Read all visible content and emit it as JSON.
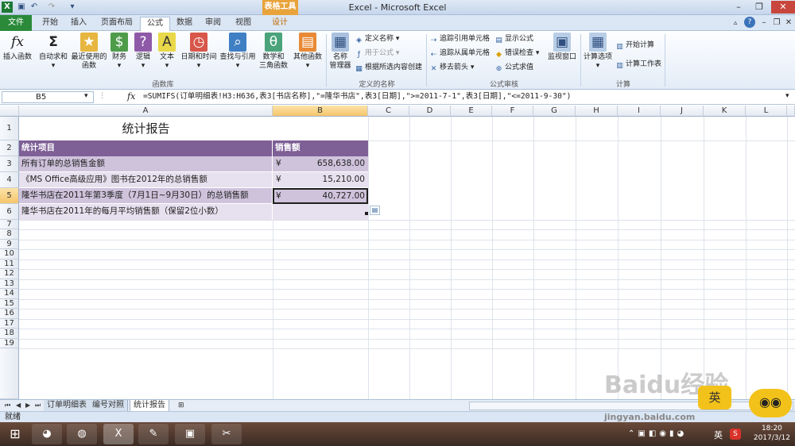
{
  "window": {
    "title": "Excel - Microsoft Excel",
    "context_tab": "表格工具"
  },
  "tabs": [
    "文件",
    "开始",
    "插入",
    "页面布局",
    "公式",
    "数据",
    "审阅",
    "视图",
    "设计"
  ],
  "ribbon": {
    "insert_fn": "插入函数",
    "autosum": "自动求和",
    "recent": "最近使用的\n函数",
    "finance": "财务",
    "logic": "逻辑",
    "text": "文本",
    "datetime": "日期和时间",
    "lookup": "查找与引用",
    "math": "数学和\n三角函数",
    "other": "其他函数",
    "group_fnlib": "函数库",
    "name_mgr": "名称\n管理器",
    "define_name": "定义名称",
    "use_in_formula": "用于公式",
    "create_from_sel": "根据所选内容创建",
    "group_names": "定义的名称",
    "trace_prec": "追踪引用单元格",
    "trace_dep": "追踪从属单元格",
    "remove_arrows": "移去箭头",
    "show_formulas": "显示公式",
    "error_check": "错误检查",
    "eval_formula": "公式求值",
    "group_audit": "公式审核",
    "watch": "监视窗口",
    "calc_opts": "计算选项",
    "calc_now": "开始计算",
    "calc_sheet": "计算工作表",
    "group_calc": "计算"
  },
  "formula_bar": {
    "name_box": "B5",
    "fx": "fx",
    "formula": "=SUMIFS(订单明细表!H3:H636,表3[书店名称],\"=隆华书店\",表3[日期],\">=2011-7-1\",表3[日期],\"<=2011-9-30\")"
  },
  "columns": [
    "A",
    "B",
    "C",
    "D",
    "E",
    "F",
    "G",
    "H",
    "I",
    "J",
    "K",
    "L"
  ],
  "rows": [
    "1",
    "2",
    "3",
    "4",
    "5",
    "6",
    "7",
    "8",
    "9",
    "10",
    "11",
    "12",
    "13",
    "14",
    "15",
    "16",
    "17",
    "18",
    "19"
  ],
  "cells": {
    "title": "统计报告",
    "h_item": "统计项目",
    "h_sales": "销售额",
    "r3a": "所有订单的总销售金额",
    "r3c": "¥",
    "r3b": "658,638.00",
    "r4a": "《MS Office高级应用》图书在2012年的总销售额",
    "r4c": "¥",
    "r4b": "15,210.00",
    "r5a": "隆华书店在2011年第3季度（7月1日~9月30日）的总销售额",
    "r5c": "¥",
    "r5b": "40,727.00",
    "r6a": "隆华书店在2011年的每月平均销售额（保留2位小数）"
  },
  "sheets": [
    "订单明细表",
    "编号对照",
    "统计报告"
  ],
  "status": {
    "ready": "就绪"
  },
  "clock": {
    "time": "18:20",
    "date": "2017/3/12"
  },
  "tray": {
    "lang": "英"
  },
  "watermark": "Baidu经验",
  "watermark_url": "jingyan.baidu.com"
}
